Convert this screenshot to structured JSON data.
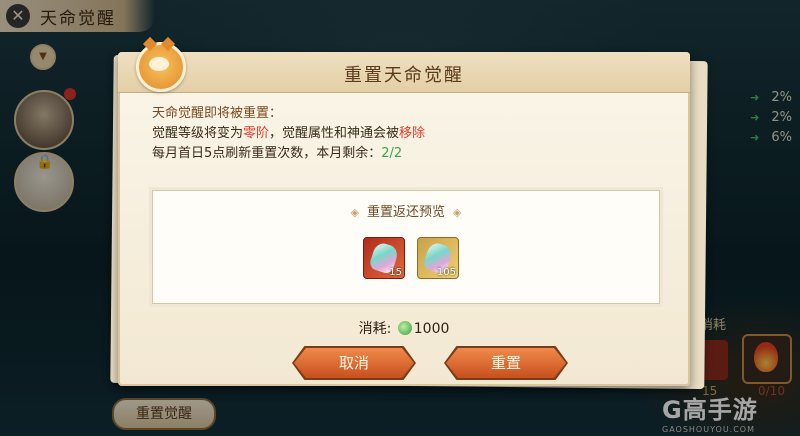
{
  "background": {
    "top_bar_title": "天命觉醒",
    "close_glyph": "✕",
    "collapse_glyph": "▼",
    "lock_glyph": "🔒",
    "stats": [
      {
        "value": "2%"
      },
      {
        "value": "2%"
      },
      {
        "value": "6%"
      }
    ],
    "right_label": "消耗",
    "counts": {
      "left": "15",
      "right": "0/10"
    },
    "bottom_button": "重置觉醒",
    "watermark": {
      "logo": "G高手游",
      "url": "GAOSHOUYOU.COM"
    }
  },
  "dialog": {
    "title": "重置天命觉醒",
    "line1": "天命觉醒即将被重置：",
    "line2_prefix": "觉醒等级将变为",
    "line2_red1": "零阶",
    "line2_mid": "，觉醒属性和神通会被",
    "line2_red2": "移除",
    "line3_prefix": "每月首日5点刷新重置次数，本月剩余：",
    "line3_green": "2/2",
    "preview_title": "重置返还预览",
    "items": [
      {
        "name": "red-gem-item",
        "count": "15"
      },
      {
        "name": "gold-gem-item",
        "count": "105"
      }
    ],
    "cost_label": "消耗:",
    "cost_value": "1000",
    "cancel_label": "取消",
    "reset_label": "重置"
  },
  "colors": {
    "accent_red": "#e33c2c",
    "accent_green": "#3aa24a",
    "button_orange": "#e0763a"
  }
}
